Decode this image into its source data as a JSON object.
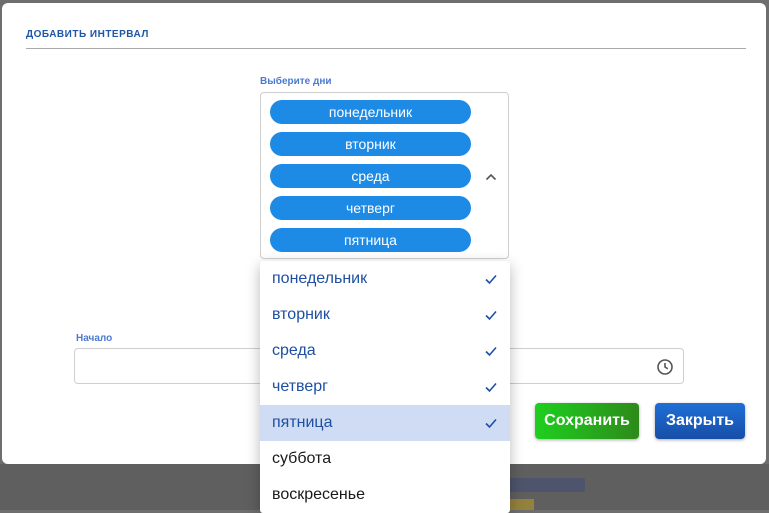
{
  "modal": {
    "title": "ДОБАВИТЬ ИНТЕРВАЛ",
    "days_label": "Выберите дни",
    "selected_days": [
      "понедельник",
      "вторник",
      "среда",
      "четверг",
      "пятница"
    ],
    "start_label": "Начало",
    "start_value": "",
    "end_value": "",
    "save_label": "Сохранить",
    "close_label": "Закрыть"
  },
  "dropdown": {
    "options": [
      {
        "label": "понедельник",
        "selected": true
      },
      {
        "label": "вторник",
        "selected": true
      },
      {
        "label": "среда",
        "selected": true
      },
      {
        "label": "четверг",
        "selected": true
      },
      {
        "label": "пятница",
        "selected": true,
        "active": true
      },
      {
        "label": "суббота",
        "selected": false
      },
      {
        "label": "воскресенье",
        "selected": false
      }
    ]
  },
  "colors": {
    "chip": "#1d8be6",
    "title": "#1e56a8",
    "save_start": "#1fcf1f",
    "save_end": "#2d8a1a",
    "close": "#174ea7",
    "active_option": "#d0dcf3"
  },
  "icons": {
    "expand": "chevron-up-icon",
    "time": "clock-icon",
    "check": "check-icon"
  }
}
